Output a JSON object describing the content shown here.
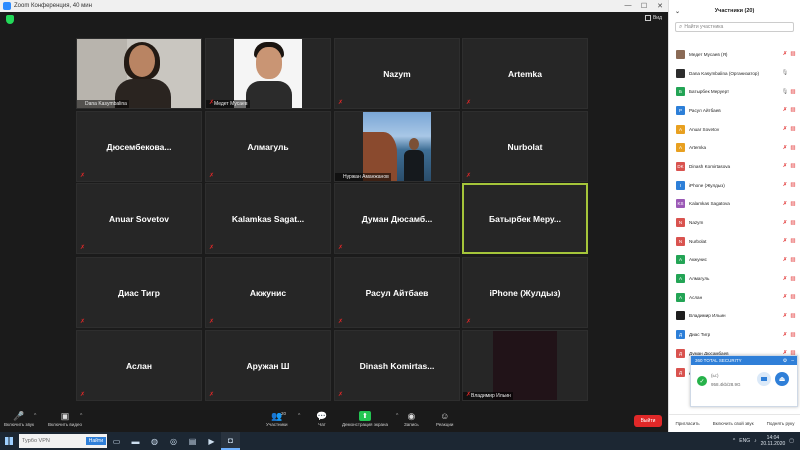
{
  "title_bar": {
    "title": "Zoom Конференция, 40 мин",
    "minimize": "—",
    "maximize": "☐",
    "close": "✕"
  },
  "view_button": {
    "label": "Вид"
  },
  "tiles": [
    {
      "name": "",
      "caption": "Dana Kasymbalina",
      "mic_muted": false,
      "photo": "woman",
      "active": false
    },
    {
      "name": "",
      "caption": "Медет Мусаев",
      "mic_muted": true,
      "photo": "man",
      "active": false
    },
    {
      "name": "Nazym",
      "caption": "",
      "mic_muted": true,
      "photo": "",
      "active": false
    },
    {
      "name": "Artemka",
      "caption": "",
      "mic_muted": true,
      "photo": "",
      "active": false
    },
    {
      "name": "Дюсембекова...",
      "caption": "",
      "mic_muted": true,
      "photo": "",
      "active": false
    },
    {
      "name": "Алмагуль",
      "caption": "",
      "mic_muted": true,
      "photo": "",
      "active": false
    },
    {
      "name": "",
      "caption": "Нуржан Аманжанов",
      "mic_muted": false,
      "photo": "lake",
      "active": false
    },
    {
      "name": "Nurbolat",
      "caption": "",
      "mic_muted": true,
      "photo": "",
      "active": false
    },
    {
      "name": "Anuar Sovetov",
      "caption": "",
      "mic_muted": true,
      "photo": "",
      "active": false
    },
    {
      "name": "Kalamkas Sagat...",
      "caption": "",
      "mic_muted": true,
      "photo": "",
      "active": false
    },
    {
      "name": "Думан Дюсамб...",
      "caption": "",
      "mic_muted": true,
      "photo": "",
      "active": false
    },
    {
      "name": "Батырбек Меру...",
      "caption": "",
      "mic_muted": false,
      "photo": "",
      "active": true
    },
    {
      "name": "Диас Тигр",
      "caption": "",
      "mic_muted": true,
      "photo": "",
      "active": false
    },
    {
      "name": "Акжунис",
      "caption": "",
      "mic_muted": true,
      "photo": "",
      "active": false
    },
    {
      "name": "Расул Айтбаев",
      "caption": "",
      "mic_muted": true,
      "photo": "",
      "active": false
    },
    {
      "name": "iPhone (Жулдыз)",
      "caption": "",
      "mic_muted": true,
      "photo": "",
      "active": false
    },
    {
      "name": "Аслан",
      "caption": "",
      "mic_muted": true,
      "photo": "",
      "active": false
    },
    {
      "name": "Аружан Ш",
      "caption": "",
      "mic_muted": true,
      "photo": "",
      "active": false
    },
    {
      "name": "Dinash Komirtas...",
      "caption": "",
      "mic_muted": true,
      "photo": "",
      "active": false
    },
    {
      "name": "",
      "caption": "Владимир Ильин",
      "mic_muted": true,
      "photo": "dark",
      "active": false
    }
  ],
  "toolbar": {
    "audio": "Включить звук",
    "video": "Включить видео",
    "participants": "Участники",
    "participants_count": "20",
    "chat": "Чат",
    "share": "Демонстрация экрана",
    "record": "Запись",
    "reactions": "Реакции",
    "leave": "Выйти"
  },
  "panel": {
    "title": "Участники (20)",
    "search_placeholder": "Найти участника",
    "participants": [
      {
        "initials": "",
        "name": "Медет Мусаев (Я)",
        "color": "#8a6a55",
        "mic": "muted",
        "cam": "off"
      },
      {
        "initials": "",
        "name": "Dana Kasymbalina (Организатор)",
        "color": "#2d2d2d",
        "mic": "on",
        "cam": "on"
      },
      {
        "initials": "Б",
        "name": "Батырбек Меруерт",
        "color": "#23a455",
        "mic": "on",
        "cam": "off"
      },
      {
        "initials": "Р",
        "name": "Расул Айтбаев",
        "color": "#2d7fd8",
        "mic": "muted",
        "cam": "off"
      },
      {
        "initials": "A",
        "name": "Anuar Sovetov",
        "color": "#e8a020",
        "mic": "muted",
        "cam": "off"
      },
      {
        "initials": "A",
        "name": "Artemka",
        "color": "#e8a020",
        "mic": "muted",
        "cam": "off"
      },
      {
        "initials": "DK",
        "name": "Dinash Komirtasova",
        "color": "#d9534f",
        "mic": "muted",
        "cam": "off"
      },
      {
        "initials": "I",
        "name": "iPhone (Жулдыз)",
        "color": "#2d7fd8",
        "mic": "muted",
        "cam": "off"
      },
      {
        "initials": "KS",
        "name": "Kalamkas Sagatova",
        "color": "#9b59b6",
        "mic": "muted",
        "cam": "off"
      },
      {
        "initials": "N",
        "name": "Nazym",
        "color": "#d9534f",
        "mic": "muted",
        "cam": "off"
      },
      {
        "initials": "N",
        "name": "Nurbolat",
        "color": "#d9534f",
        "mic": "muted",
        "cam": "off"
      },
      {
        "initials": "А",
        "name": "Акжунис",
        "color": "#23a455",
        "mic": "muted",
        "cam": "off"
      },
      {
        "initials": "А",
        "name": "Алмагуль",
        "color": "#23a455",
        "mic": "muted",
        "cam": "off"
      },
      {
        "initials": "А",
        "name": "Аслан",
        "color": "#23a455",
        "mic": "muted",
        "cam": "off"
      },
      {
        "initials": "",
        "name": "Владимир Ильин",
        "color": "#1e1e1e",
        "mic": "muted",
        "cam": "off"
      },
      {
        "initials": "Д",
        "name": "Диас Тигр",
        "color": "#2d7fd8",
        "mic": "muted",
        "cam": "off"
      },
      {
        "initials": "Д",
        "name": "Думан Дюсамбаев",
        "color": "#d9534f",
        "mic": "muted",
        "cam": "off"
      },
      {
        "initials": "Д",
        "name": "Дюсембекова Назым",
        "color": "#d9534f",
        "mic": "muted",
        "cam": "off"
      }
    ],
    "footer": {
      "invite": "Пригласить",
      "unmute_self": "Включить свой звук",
      "raise_hand": "Поднять руку"
    }
  },
  "popup": {
    "title": "360 TOTAL SECURITY",
    "line1": "(ы:)",
    "line2": "958.4kb/28.9G"
  },
  "taskbar": {
    "search_placeholder": "Турбо VPN",
    "search_button": "Найти",
    "lang": "ENG",
    "time": "14:04",
    "date": "20.11.2020"
  }
}
